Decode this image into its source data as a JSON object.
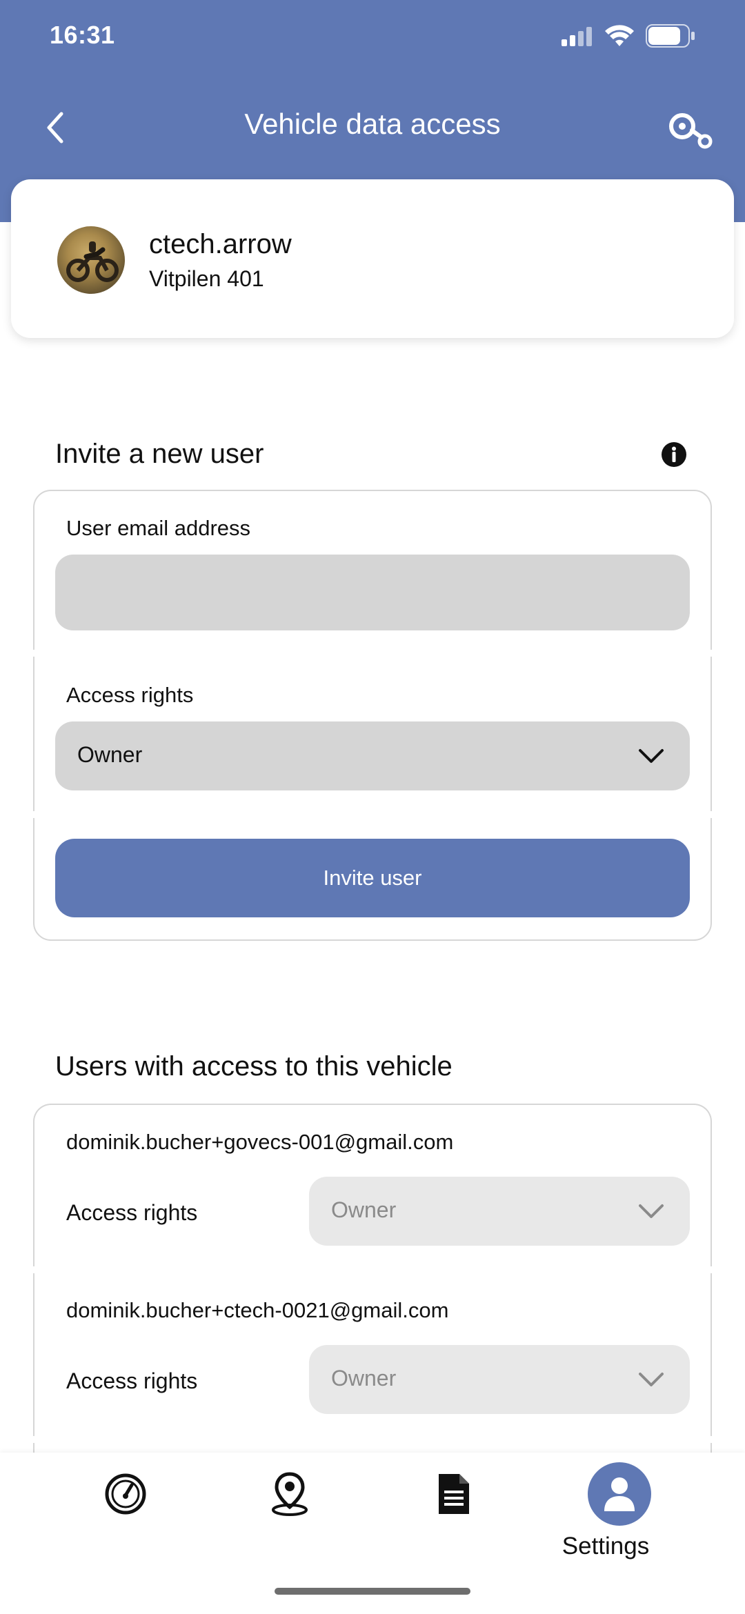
{
  "status_bar": {
    "time": "16:31"
  },
  "header": {
    "title": "Vehicle data access"
  },
  "vehicle": {
    "name": "ctech.arrow",
    "model": "Vitpilen 401"
  },
  "invite": {
    "title": "Invite a new user",
    "email_label": "User email address",
    "email_value": "",
    "access_label": "Access rights",
    "access_value": "Owner",
    "button_label": "Invite user"
  },
  "users_section": {
    "title": "Users with access to this vehicle",
    "users": [
      {
        "email": "dominik.bucher+govecs-001@gmail.com",
        "access_label": "Access rights",
        "access_value": "Owner"
      },
      {
        "email": "dominik.bucher+ctech-0021@gmail.com",
        "access_label": "Access rights",
        "access_value": "Owner"
      }
    ]
  },
  "bottom_nav": {
    "items": [
      {
        "icon": "speedometer-icon",
        "label": ""
      },
      {
        "icon": "map-pin-icon",
        "label": ""
      },
      {
        "icon": "document-icon",
        "label": ""
      },
      {
        "icon": "user-icon",
        "label": "Settings",
        "active": true
      }
    ]
  },
  "colors": {
    "primary": "#5f78b4",
    "input_bg": "#d5d5d5",
    "disabled_select_bg": "#e8e8e8"
  }
}
